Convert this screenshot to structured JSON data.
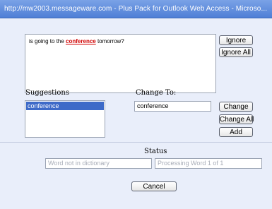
{
  "window": {
    "title": "http://mw2003.messageware.com - Plus Pack for Outlook Web Access - Microso..."
  },
  "context": {
    "before": "is going to the ",
    "misspelled": "conference",
    "after": " tomorrow?"
  },
  "buttons": {
    "ignore": "Ignore",
    "ignore_all": "Ignore All",
    "change": "Change",
    "change_all": "Change All",
    "add": "Add",
    "cancel": "Cancel"
  },
  "suggestions": {
    "label": "Suggestions",
    "items": [
      "conference"
    ]
  },
  "change_to": {
    "label": "Change To:",
    "value": "conference"
  },
  "status": {
    "label": "Status",
    "message": "Word not in dictionary",
    "progress": "Processing Word 1 of 1"
  }
}
